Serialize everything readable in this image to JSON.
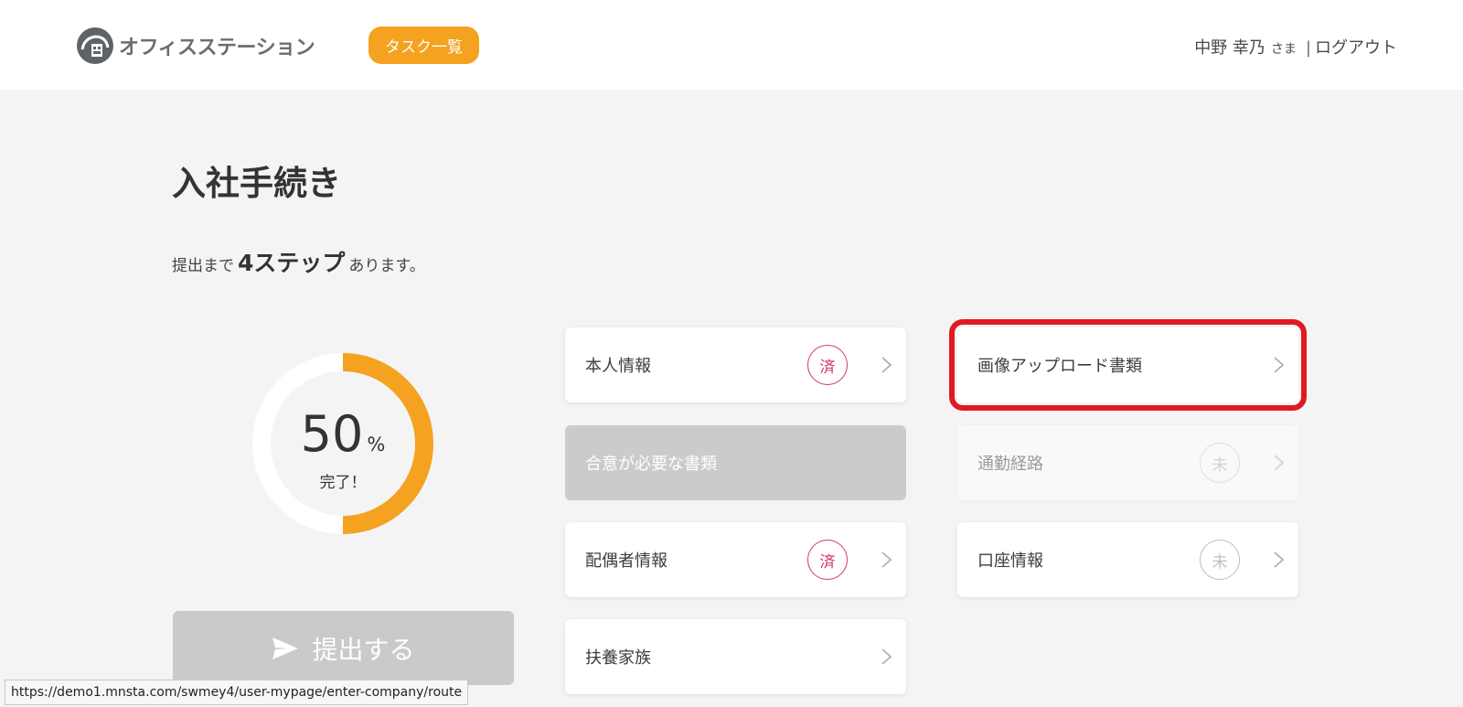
{
  "header": {
    "logo_text": "オフィスステーション",
    "task_button": "タスク一覧",
    "user_name": "中野 幸乃",
    "user_suffix": "さま",
    "separator": "|",
    "logout": "ログアウト"
  },
  "main": {
    "title": "入社手続き",
    "steps_prefix": "提出まで",
    "steps_count": "4ステップ",
    "steps_suffix": "あります。",
    "progress": {
      "value": 50,
      "value_text": "50",
      "unit": "%",
      "done_label": "完了！",
      "colors": {
        "fill": "#f4a21f",
        "track": "#ffffff"
      }
    },
    "submit_label": "提出する"
  },
  "cards": [
    {
      "label": "本人情報",
      "badge": "済",
      "state": "done"
    },
    {
      "label": "画像アップロード書類",
      "badge": "",
      "state": "highlighted"
    },
    {
      "label": "合意が必要な書類",
      "badge": "",
      "state": "disabled"
    },
    {
      "label": "通勤経路",
      "badge": "未",
      "state": "faded"
    },
    {
      "label": "配偶者情報",
      "badge": "済",
      "state": "done"
    },
    {
      "label": "口座情報",
      "badge": "未",
      "state": "todo"
    },
    {
      "label": "扶養家族",
      "badge": "",
      "state": "normal"
    }
  ],
  "statusbar": {
    "url": "https://demo1.mnsta.com/swmey4/user-mypage/enter-company/route"
  },
  "colors": {
    "accent": "#f4a21f",
    "done": "#d6336c",
    "highlight": "#e01a22"
  }
}
